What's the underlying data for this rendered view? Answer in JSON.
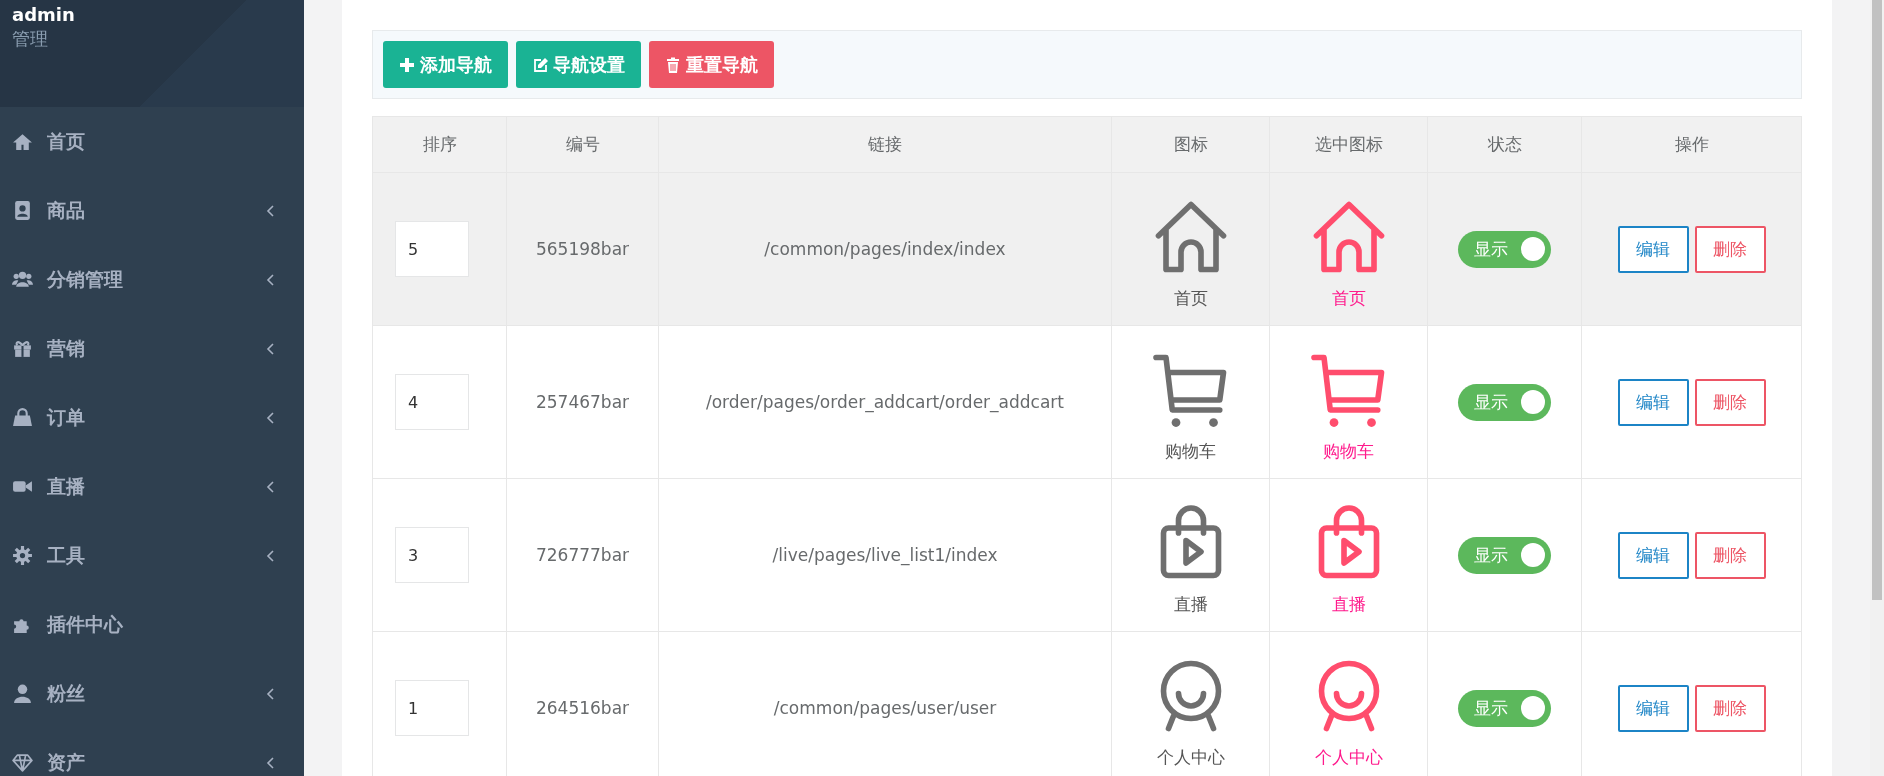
{
  "sidebar": {
    "user": {
      "name": "admin",
      "role": "管理"
    },
    "items": [
      {
        "label": "首页",
        "expandable": false
      },
      {
        "label": "商品",
        "expandable": true
      },
      {
        "label": "分销管理",
        "expandable": true
      },
      {
        "label": "营销",
        "expandable": true
      },
      {
        "label": "订单",
        "expandable": true
      },
      {
        "label": "直播",
        "expandable": true
      },
      {
        "label": "工具",
        "expandable": true
      },
      {
        "label": "插件中心",
        "expandable": false
      },
      {
        "label": "粉丝",
        "expandable": true
      },
      {
        "label": "资产",
        "expandable": true
      }
    ]
  },
  "toolbar": {
    "buttons": [
      {
        "label": "添加导航",
        "kind": "add"
      },
      {
        "label": "导航设置",
        "kind": "settings"
      },
      {
        "label": "重置导航",
        "kind": "reset"
      }
    ]
  },
  "table": {
    "columns": [
      "排序",
      "编号",
      "链接",
      "图标",
      "选中图标",
      "状态",
      "操作"
    ],
    "rows": [
      {
        "order": "5",
        "code": "565198bar",
        "link": "/common/pages/index/index",
        "icon_label": "首页",
        "selected_icon_label": "首页",
        "status": {
          "label": "显示",
          "on": true
        },
        "actions": [
          "编辑",
          "删除"
        ],
        "hovered": true
      },
      {
        "order": "4",
        "code": "257467bar",
        "link": "/order/pages/order_addcart/order_addcart",
        "icon_label": "购物车",
        "selected_icon_label": "购物车",
        "status": {
          "label": "显示",
          "on": true
        },
        "actions": [
          "编辑",
          "删除"
        ],
        "hovered": false
      },
      {
        "order": "3",
        "code": "726777bar",
        "link": "/live/pages/live_list1/index",
        "icon_label": "直播",
        "selected_icon_label": "直播",
        "status": {
          "label": "显示",
          "on": true
        },
        "actions": [
          "编辑",
          "删除"
        ],
        "hovered": false
      },
      {
        "order": "1",
        "code": "264516bar",
        "link": "/common/pages/user/user",
        "icon_label": "个人中心",
        "selected_icon_label": "个人中心",
        "status": {
          "label": "显示",
          "on": true
        },
        "actions": [
          "编辑",
          "删除"
        ],
        "hovered": false
      }
    ]
  }
}
